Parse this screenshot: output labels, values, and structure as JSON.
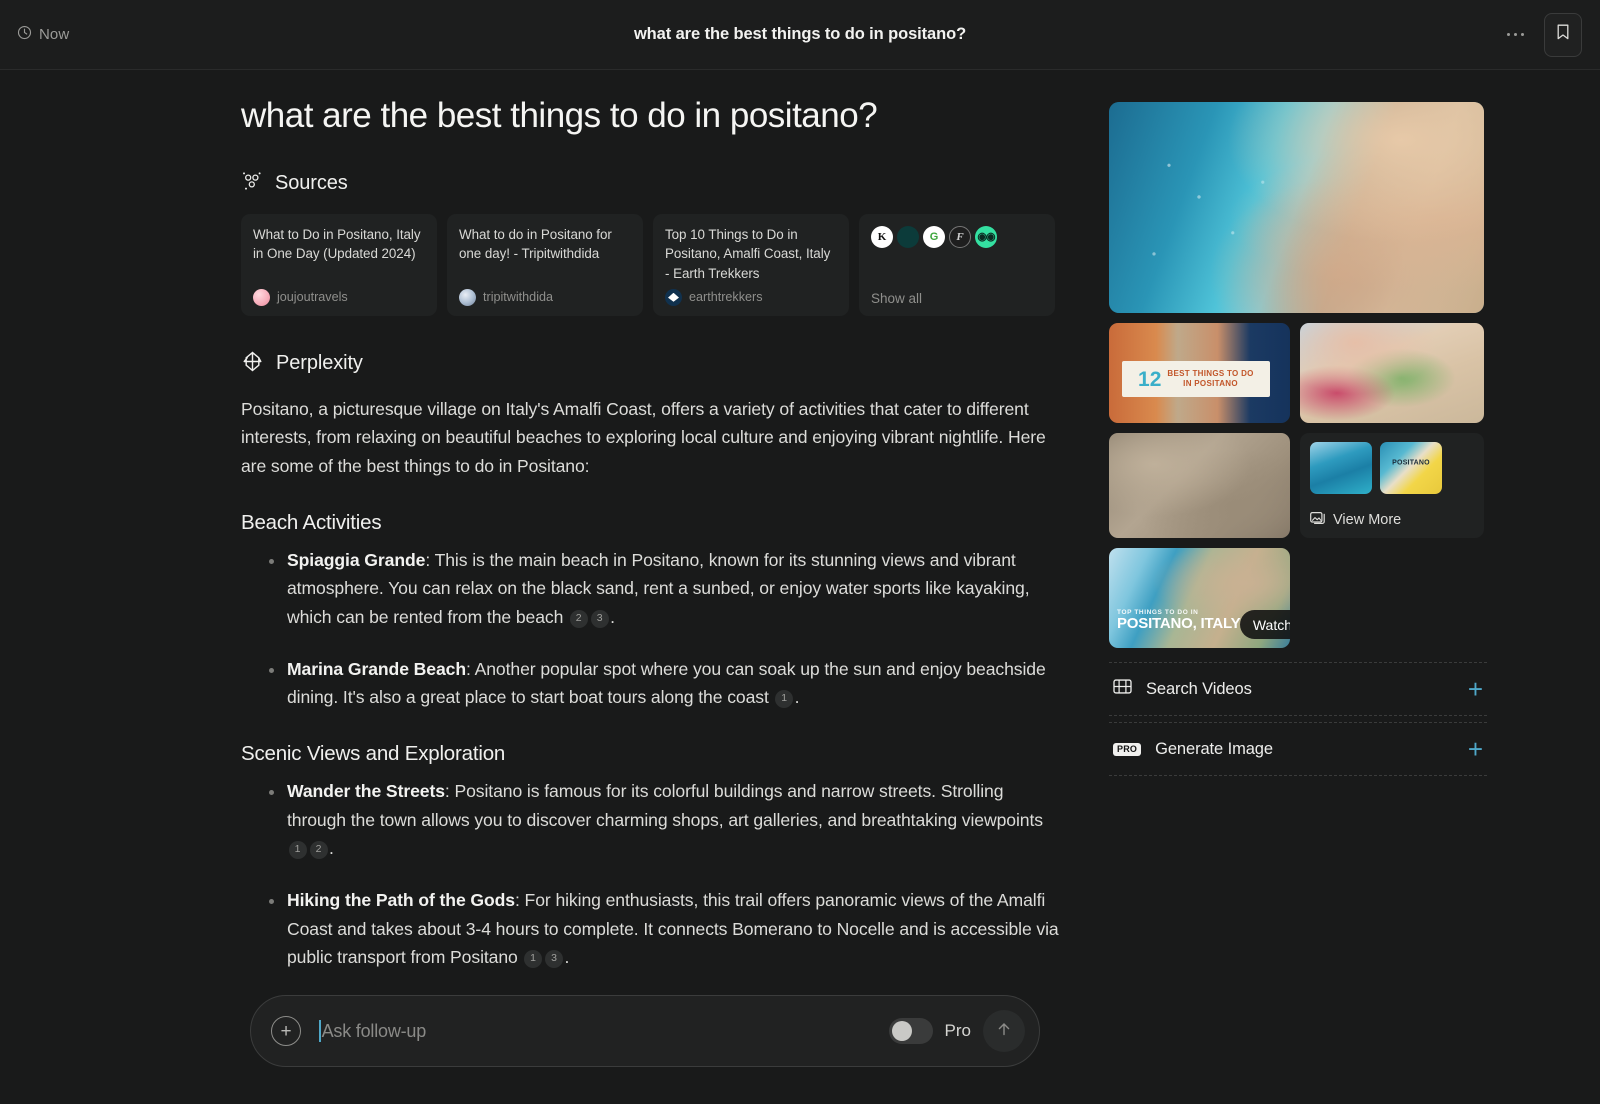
{
  "topbar": {
    "time_label": "Now",
    "clock_icon": "clock-icon",
    "title": "what are the best things to do in positano?",
    "more_icon": "more-options-icon",
    "bookmark_icon": "bookmark-icon"
  },
  "main": {
    "question": "what are the best things to do in positano?",
    "sources": {
      "icon": "sources-icon",
      "heading": "Sources",
      "cards": [
        {
          "title": "What to Do in Positano, Italy in One Day (Updated 2024)",
          "site": "joujoutravels",
          "favicon": "joujoutravels-favicon"
        },
        {
          "title": "What to do in Positano for one day! - Tripitwithdida",
          "site": "tripitwithdida",
          "favicon": "tripitwithdida-favicon"
        },
        {
          "title": "Top 10 Things to Do in Positano, Amalfi Coast, Italy - Earth Trekkers",
          "site": "earthtrekkers",
          "favicon": "earthtrekkers-favicon"
        }
      ],
      "show_all": {
        "label": "Show all",
        "favicons": [
          "K",
          "●",
          "G",
          "F",
          "◉◉"
        ]
      }
    },
    "answer": {
      "icon": "perplexity-logo-icon",
      "heading": "Perplexity",
      "intro": "Positano, a picturesque village on Italy's Amalfi Coast, offers a variety of activities that cater to different interests, from relaxing on beautiful beaches to exploring local culture and enjoying vibrant nightlife. Here are some of the best things to do in Positano:",
      "sections": [
        {
          "heading": "Beach Activities",
          "items": [
            {
              "term": "Spiaggia Grande",
              "text": ": This is the main beach in Positano, known for its stunning views and vibrant atmosphere. You can relax on the black sand, rent a sunbed, or enjoy water sports like kayaking, which can be rented from the beach ",
              "citations": [
                "2",
                "3"
              ],
              "tail": "."
            },
            {
              "term": "Marina Grande Beach",
              "text": ": Another popular spot where you can soak up the sun and enjoy beachside dining. It's also a great place to start boat tours along the coast ",
              "citations": [
                "1"
              ],
              "tail": "."
            }
          ]
        },
        {
          "heading": "Scenic Views and Exploration",
          "items": [
            {
              "term": "Wander the Streets",
              "text": ": Positano is famous for its colorful buildings and narrow streets. Strolling through the town allows you to discover charming shops, art galleries, and breathtaking viewpoints ",
              "citations": [
                "1",
                "2"
              ],
              "tail": "."
            },
            {
              "term": "Hiking the Path of the Gods",
              "text": ": For hiking enthusiasts, this trail offers panoramic views of the Amalfi Coast and takes about 3-4 hours to complete. It connects Bomerano to Nocelle and is accessible via public transport from Positano ",
              "citations": [
                "1",
                "3"
              ],
              "tail": "."
            }
          ]
        }
      ]
    }
  },
  "askbar": {
    "add_icon": "plus-circle-icon",
    "placeholder": "Ask follow-up",
    "pro_label": "Pro",
    "pro_enabled": false,
    "send_icon": "arrow-up-icon"
  },
  "sidebar": {
    "hero": {
      "name": "positano-coastline-photo",
      "alt": "Aerial view of Positano beach and turquoise sea"
    },
    "thumbs": [
      {
        "name": "12-best-things-thumb",
        "overlay_number": "12",
        "overlay_line1": "BEST THINGS TO DO",
        "overlay_line2": "IN POSITANO"
      },
      {
        "name": "watercolor-positano-thumb"
      },
      {
        "name": "aerial-beach-thumb"
      }
    ],
    "view_more": {
      "label": "View More",
      "icon": "images-icon",
      "mini_caption": "POSITANO"
    },
    "video": {
      "name": "positano-italy-video",
      "caption_line1": "TOP THINGS TO DO IN",
      "caption_line2": "POSITANO, ITALY",
      "watch_label": "Watch",
      "play_icon": "play-circle-icon"
    },
    "actions": [
      {
        "label": "Search Videos",
        "icon": "film-icon",
        "plus": "+",
        "badge": null
      },
      {
        "label": "Generate Image",
        "icon": "pro-badge-icon",
        "plus": "+",
        "badge": "PRO"
      }
    ]
  },
  "colors": {
    "background": "#191A1A",
    "panel": "#202222",
    "accent_teal": "#4FA8C9",
    "text_primary": "#F0F0EE",
    "text_muted": "#8F8F8C"
  }
}
